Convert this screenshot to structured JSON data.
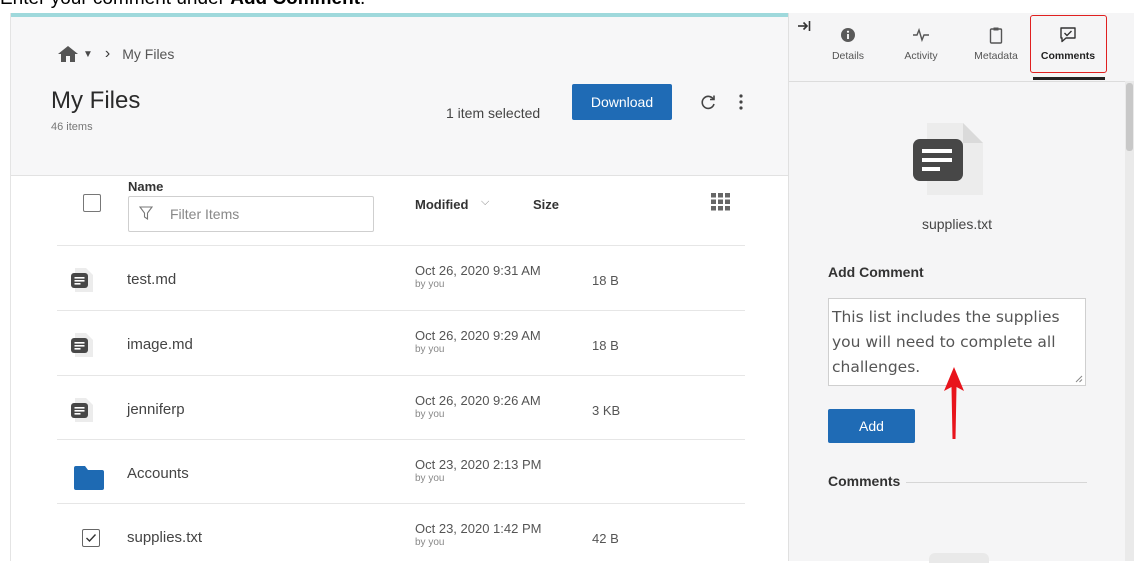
{
  "instruction": {
    "prefix": "Enter your comment under ",
    "bold": "Add Comment",
    "suffix": "."
  },
  "breadcrumb": {
    "home_icon": "home-icon",
    "current": "My Files"
  },
  "header": {
    "title": "My Files",
    "item_count": "46 items",
    "selection_status": "1 item selected",
    "download_label": "Download"
  },
  "table": {
    "name_header": "Name",
    "filter_placeholder": "Filter Items",
    "modified_header": "Modified",
    "size_header": "Size",
    "rows": [
      {
        "name": "test.md",
        "modified": "Oct 26, 2020 9:31 AM",
        "by": "by you",
        "size": "18 B",
        "type": "file"
      },
      {
        "name": "image.md",
        "modified": "Oct 26, 2020 9:29 AM",
        "by": "by you",
        "size": "18 B",
        "type": "file"
      },
      {
        "name": "jenniferp",
        "modified": "Oct 26, 2020 9:26 AM",
        "by": "by you",
        "size": "3 KB",
        "type": "file"
      },
      {
        "name": "Accounts",
        "modified": "Oct 23, 2020 2:13 PM",
        "by": "by you",
        "size": "",
        "type": "folder"
      },
      {
        "name": "supplies.txt",
        "modified": "Oct 23, 2020 1:42 PM",
        "by": "by you",
        "size": "42 B",
        "type": "file",
        "selected": true
      }
    ]
  },
  "sidebar": {
    "tabs": [
      {
        "label": "Details",
        "icon": "info-icon"
      },
      {
        "label": "Activity",
        "icon": "activity-icon"
      },
      {
        "label": "Metadata",
        "icon": "clipboard-icon"
      },
      {
        "label": "Comments",
        "icon": "comment-icon",
        "active": true
      }
    ],
    "file_name": "supplies.txt",
    "add_comment_heading": "Add Comment",
    "comment_text": "This list includes the supplies you will need to complete all challenges.",
    "add_button": "Add",
    "comments_heading": "Comments"
  },
  "colors": {
    "primary": "#1f6bb5",
    "highlight": "#e02020",
    "accent_bar": "#9fd9dc"
  }
}
